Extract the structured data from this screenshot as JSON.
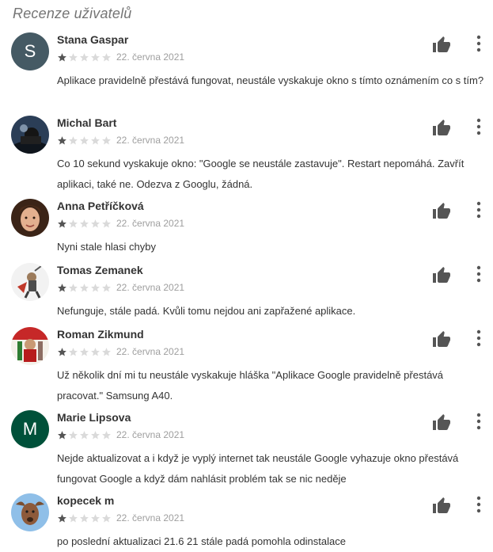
{
  "section_title": "Recenze uživatelů",
  "icons": {
    "like": "thumbs-up-icon",
    "more": "more-vertical-icon",
    "star_filled": "star-filled-icon",
    "star_empty": "star-empty-icon"
  },
  "colors": {
    "star_filled": "#555555",
    "star_empty": "#dadada",
    "icon": "#555555"
  },
  "reviews": [
    {
      "author": "Stana Gaspar",
      "avatar_letter": "S",
      "avatar_color": "#455a64",
      "rating": 1,
      "max_rating": 5,
      "date": "22. června 2021",
      "text": "Aplikace pravidelně přestává fungovat, neustále vyskakuje okno s tímto oznámením co s tím?"
    },
    {
      "author": "Michal Bart",
      "avatar_letter": "",
      "avatar_color": "#1f2f44",
      "rating": 1,
      "max_rating": 5,
      "date": "22. června 2021",
      "text": "Co 10 sekund vyskakuje okno: \"Google se neustále zastavuje\". Restart nepomáhá. Zavřít aplikaci, také ne. Odezva z Googlu, žádná."
    },
    {
      "author": "Anna Petříčková",
      "avatar_letter": "",
      "avatar_color": "#8a5a3c",
      "rating": 1,
      "max_rating": 5,
      "date": "22. června 2021",
      "text": "Nyni stale hlasi chyby"
    },
    {
      "author": "Tomas Zemanek",
      "avatar_letter": "",
      "avatar_color": "#f2f2f2",
      "rating": 1,
      "max_rating": 5,
      "date": "22. června 2021",
      "text": "Nefunguje, stále padá. Kvůli tomu nejdou ani zapřažené aplikace."
    },
    {
      "author": "Roman Zikmund",
      "avatar_letter": "",
      "avatar_color": "#c62828",
      "rating": 1,
      "max_rating": 5,
      "date": "22. června 2021",
      "text": "Už několik dní mi tu neustále vyskakuje hláška \"Aplikace Google pravidelně přestává pracovat.\" Samsung A40."
    },
    {
      "author": "Marie Lipsova",
      "avatar_letter": "M",
      "avatar_color": "#00513a",
      "rating": 1,
      "max_rating": 5,
      "date": "22. června 2021",
      "text": "Nejde aktualizovat a i když je vyplý internet tak neustále Google vyhazuje okno přestává fungovat Google a když dám nahlásit problém tak se nic neděje"
    },
    {
      "author": "kopecek m",
      "avatar_letter": "",
      "avatar_color": "#6fa5d8",
      "rating": 1,
      "max_rating": 5,
      "date": "22. června 2021",
      "text": "po poslední aktualizaci 21.6 21 stále padá pomohla odinstalace"
    }
  ]
}
